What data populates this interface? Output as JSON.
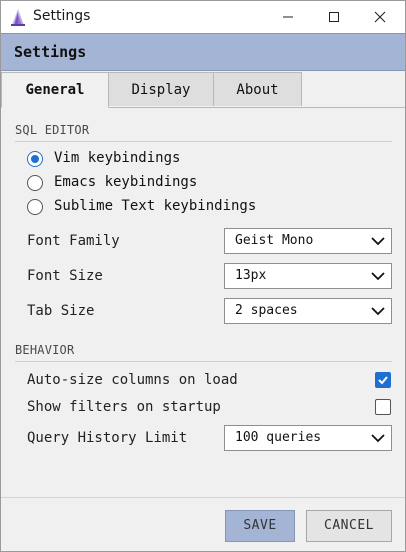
{
  "window": {
    "title": "Settings"
  },
  "header": {
    "title": "Settings"
  },
  "tabs": [
    {
      "label": "General",
      "active": true
    },
    {
      "label": "Display",
      "active": false
    },
    {
      "label": "About",
      "active": false
    }
  ],
  "sql_editor": {
    "label": "SQL EDITOR",
    "keybindings": [
      {
        "label": "Vim keybindings",
        "selected": true
      },
      {
        "label": "Emacs keybindings",
        "selected": false
      },
      {
        "label": "Sublime Text keybindings",
        "selected": false
      }
    ],
    "font_family": {
      "label": "Font Family",
      "value": "Geist Mono"
    },
    "font_size": {
      "label": "Font Size",
      "value": "13px"
    },
    "tab_size": {
      "label": "Tab Size",
      "value": "2 spaces"
    }
  },
  "behavior": {
    "label": "BEHAVIOR",
    "auto_size": {
      "label": "Auto-size columns on load",
      "checked": true
    },
    "show_filters": {
      "label": "Show filters on startup",
      "checked": false
    },
    "history_limit": {
      "label": "Query History Limit",
      "value": "100 queries"
    }
  },
  "footer": {
    "save_label": "SAVE",
    "cancel_label": "CANCEL"
  },
  "colors": {
    "accent": "#1e6fd0",
    "header_band": "#a4b4d4",
    "save_button": "#a4b4d4"
  },
  "icons": {
    "app": "app-logo-icon",
    "minimize": "minimize-icon",
    "maximize": "maximize-icon",
    "close": "close-icon",
    "dropdown": "chevron-down-icon",
    "check": "checkmark-icon"
  }
}
